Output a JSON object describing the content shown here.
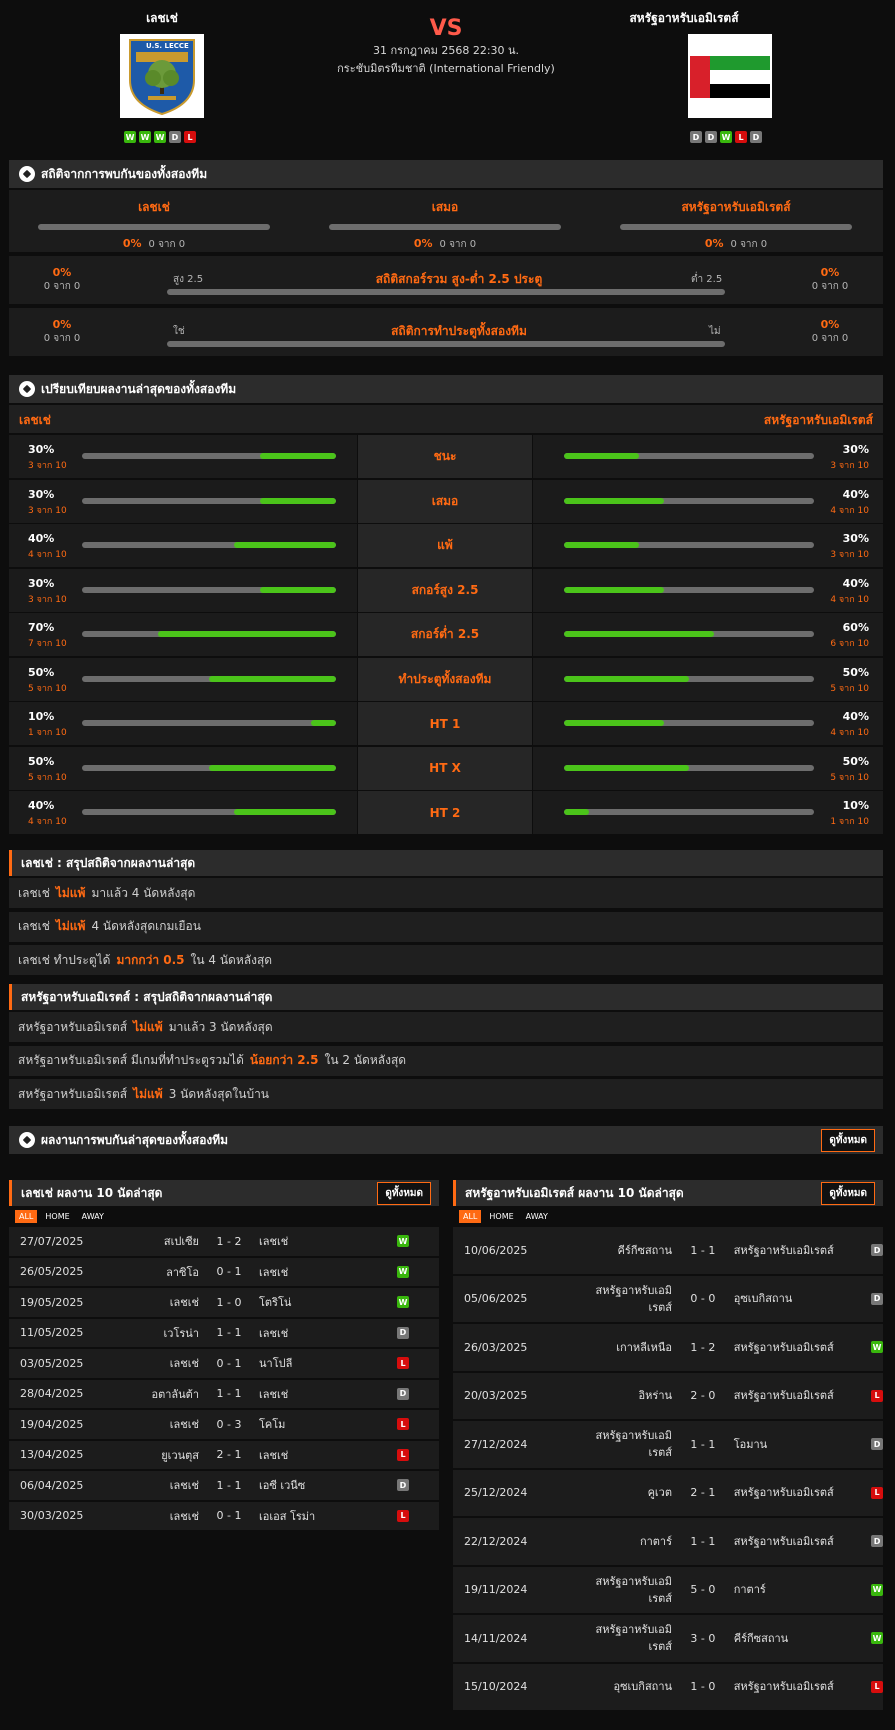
{
  "header": {
    "home_team": "เลชเช่",
    "away_team": "สหรัฐอาหรับเอมิเรตส์",
    "vs": "VS",
    "datetime": "31 กรกฎาคม 2568 22:30 น.",
    "competition": "กระชับมิตรทีมชาติ (International Friendly)",
    "home_logo_text": "U.S. LECCE",
    "home_form": [
      "W",
      "W",
      "W",
      "D",
      "L"
    ],
    "away_form": [
      "D",
      "D",
      "W",
      "L",
      "D"
    ]
  },
  "h2h": {
    "title": "สถิติจากการพบกันของทั้งสองทีม",
    "cols": [
      {
        "label": "เลชเช่",
        "pct": "0%",
        "count": "0 จาก 0"
      },
      {
        "label": "เสมอ",
        "pct": "0%",
        "count": "0 จาก 0"
      },
      {
        "label": "สหรัฐอาหรับเอมิเรตส์",
        "pct": "0%",
        "count": "0 จาก 0"
      }
    ],
    "ou": {
      "title": "สถิติสกอร์รวม สูง-ต่ำ 2.5 ประตู",
      "left_label": "สูง 2.5",
      "right_label": "ต่ำ 2.5",
      "left_pct": "0%",
      "left_count": "0 จาก 0",
      "right_pct": "0%",
      "right_count": "0 จาก 0"
    },
    "btts": {
      "title": "สถิติการทำประตูทั้งสองทีม",
      "left_label": "ใช่",
      "right_label": "ไม่",
      "left_pct": "0%",
      "left_count": "0 จาก 0",
      "right_pct": "0%",
      "right_count": "0 จาก 0"
    }
  },
  "compare": {
    "title": "เปรียบเทียบผลงานล่าสุดของทั้งสองทีม",
    "home_label": "เลชเช่",
    "away_label": "สหรัฐอาหรับเอมิเรตส์",
    "rows": [
      {
        "label": "ชนะ",
        "home_pct": "30%",
        "home_count": "3 จาก 10",
        "home_value": 0.3,
        "away_pct": "30%",
        "away_count": "3 จาก 10",
        "away_value": 0.3
      },
      {
        "label": "เสมอ",
        "home_pct": "30%",
        "home_count": "3 จาก 10",
        "home_value": 0.3,
        "away_pct": "40%",
        "away_count": "4 จาก 10",
        "away_value": 0.4
      },
      {
        "label": "แพ้",
        "home_pct": "40%",
        "home_count": "4 จาก 10",
        "home_value": 0.4,
        "away_pct": "30%",
        "away_count": "3 จาก 10",
        "away_value": 0.3
      },
      {
        "label": "สกอร์สูง 2.5",
        "home_pct": "30%",
        "home_count": "3 จาก 10",
        "home_value": 0.3,
        "away_pct": "40%",
        "away_count": "4 จาก 10",
        "away_value": 0.4
      },
      {
        "label": "สกอร์ต่ำ 2.5",
        "home_pct": "70%",
        "home_count": "7 จาก 10",
        "home_value": 0.7,
        "away_pct": "60%",
        "away_count": "6 จาก 10",
        "away_value": 0.6
      },
      {
        "label": "ทำประตูทั้งสองทีม",
        "home_pct": "50%",
        "home_count": "5 จาก 10",
        "home_value": 0.5,
        "away_pct": "50%",
        "away_count": "5 จาก 10",
        "away_value": 0.5
      },
      {
        "label": "HT 1",
        "home_pct": "10%",
        "home_count": "1 จาก 10",
        "home_value": 0.1,
        "away_pct": "40%",
        "away_count": "4 จาก 10",
        "away_value": 0.4
      },
      {
        "label": "HT X",
        "home_pct": "50%",
        "home_count": "5 จาก 10",
        "home_value": 0.5,
        "away_pct": "50%",
        "away_count": "5 จาก 10",
        "away_value": 0.5
      },
      {
        "label": "HT 2",
        "home_pct": "40%",
        "home_count": "4 จาก 10",
        "home_value": 0.4,
        "away_pct": "10%",
        "away_count": "1 จาก 10",
        "away_value": 0.1
      }
    ]
  },
  "home_summary": {
    "title": "เลชเช่ : สรุปสถิติจากผลงานล่าสุด",
    "lines": [
      {
        "pre": "เลชเช่",
        "hl": "ไม่แพ้",
        "post": "มาแล้ว 4 นัดหลังสุด"
      },
      {
        "pre": "เลชเช่",
        "hl": "ไม่แพ้",
        "post": "4 นัดหลังสุดเกมเยือน"
      },
      {
        "pre": "เลชเช่ ทำประตูได้",
        "hl": "มากกว่า 0.5",
        "post": "ใน 4 นัดหลังสุด"
      }
    ]
  },
  "away_summary": {
    "title": "สหรัฐอาหรับเอมิเรตส์ : สรุปสถิติจากผลงานล่าสุด",
    "lines": [
      {
        "pre": "สหรัฐอาหรับเอมิเรตส์",
        "hl": "ไม่แพ้",
        "post": "มาแล้ว 3 นัดหลังสุด"
      },
      {
        "pre": "สหรัฐอาหรับเอมิเรตส์ มีเกมที่ทำประตูรวมได้",
        "hl": "น้อยกว่า 2.5",
        "post": "ใน 2 นัดหลังสุด"
      },
      {
        "pre": "สหรัฐอาหรับเอมิเรตส์",
        "hl": "ไม่แพ้",
        "post": "3 นัดหลังสุดในบ้าน"
      }
    ]
  },
  "h2h_results": {
    "title": "ผลงานการพบกันล่าสุดของทั้งสองทีม",
    "view_all": "ดูทั้งหมด"
  },
  "tabs": [
    "ALL",
    "HOME",
    "AWAY"
  ],
  "home_last": {
    "title": "เลชเช่ ผลงาน 10 นัดล่าสุด",
    "view_all": "ดูทั้งหมด",
    "matches": [
      {
        "date": "27/07/2025",
        "home": "สเปเซีย",
        "score": "1 - 2",
        "away": "เลชเช่",
        "res": "W"
      },
      {
        "date": "26/05/2025",
        "home": "ลาซิโอ",
        "score": "0 - 1",
        "away": "เลชเช่",
        "res": "W"
      },
      {
        "date": "19/05/2025",
        "home": "เลชเช่",
        "score": "1 - 0",
        "away": "โตริโน่",
        "res": "W"
      },
      {
        "date": "11/05/2025",
        "home": "เวโรน่า",
        "score": "1 - 1",
        "away": "เลชเช่",
        "res": "D"
      },
      {
        "date": "03/05/2025",
        "home": "เลชเช่",
        "score": "0 - 1",
        "away": "นาโปลี",
        "res": "L"
      },
      {
        "date": "28/04/2025",
        "home": "อตาลันต้า",
        "score": "1 - 1",
        "away": "เลชเช่",
        "res": "D"
      },
      {
        "date": "19/04/2025",
        "home": "เลชเช่",
        "score": "0 - 3",
        "away": "โคโม",
        "res": "L"
      },
      {
        "date": "13/04/2025",
        "home": "ยูเวนตุส",
        "score": "2 - 1",
        "away": "เลชเช่",
        "res": "L"
      },
      {
        "date": "06/04/2025",
        "home": "เลชเช่",
        "score": "1 - 1",
        "away": "เอซี เวนีซ",
        "res": "D"
      },
      {
        "date": "30/03/2025",
        "home": "เลชเช่",
        "score": "0 - 1",
        "away": "เอเอส โรม่า",
        "res": "L"
      }
    ]
  },
  "away_last": {
    "title": "สหรัฐอาหรับเอมิเรตส์ ผลงาน 10 นัดล่าสุด",
    "view_all": "ดูทั้งหมด",
    "matches": [
      {
        "date": "10/06/2025",
        "home": "คีร์กีซสถาน",
        "score": "1 - 1",
        "away": "สหรัฐอาหรับเอมิเรตส์",
        "res": "D"
      },
      {
        "date": "05/06/2025",
        "home": "สหรัฐอาหรับเอมิเรตส์",
        "score": "0 - 0",
        "away": "อุซเบกิสถาน",
        "res": "D"
      },
      {
        "date": "26/03/2025",
        "home": "เกาหลีเหนือ",
        "score": "1 - 2",
        "away": "สหรัฐอาหรับเอมิเรตส์",
        "res": "W"
      },
      {
        "date": "20/03/2025",
        "home": "อิหร่าน",
        "score": "2 - 0",
        "away": "สหรัฐอาหรับเอมิเรตส์",
        "res": "L"
      },
      {
        "date": "27/12/2024",
        "home": "สหรัฐอาหรับเอมิเรตส์",
        "score": "1 - 1",
        "away": "โอมาน",
        "res": "D"
      },
      {
        "date": "25/12/2024",
        "home": "คูเวต",
        "score": "2 - 1",
        "away": "สหรัฐอาหรับเอมิเรตส์",
        "res": "L"
      },
      {
        "date": "22/12/2024",
        "home": "กาตาร์",
        "score": "1 - 1",
        "away": "สหรัฐอาหรับเอมิเรตส์",
        "res": "D"
      },
      {
        "date": "19/11/2024",
        "home": "สหรัฐอาหรับเอมิเรตส์",
        "score": "5 - 0",
        "away": "กาตาร์",
        "res": "W"
      },
      {
        "date": "14/11/2024",
        "home": "สหรัฐอาหรับเอมิเรตส์",
        "score": "3 - 0",
        "away": "คีร์กีซสถาน",
        "res": "W"
      },
      {
        "date": "15/10/2024",
        "home": "อุซเบกิสถาน",
        "score": "1 - 0",
        "away": "สหรัฐอาหรับเอมิเรตส์",
        "res": "L"
      }
    ]
  }
}
